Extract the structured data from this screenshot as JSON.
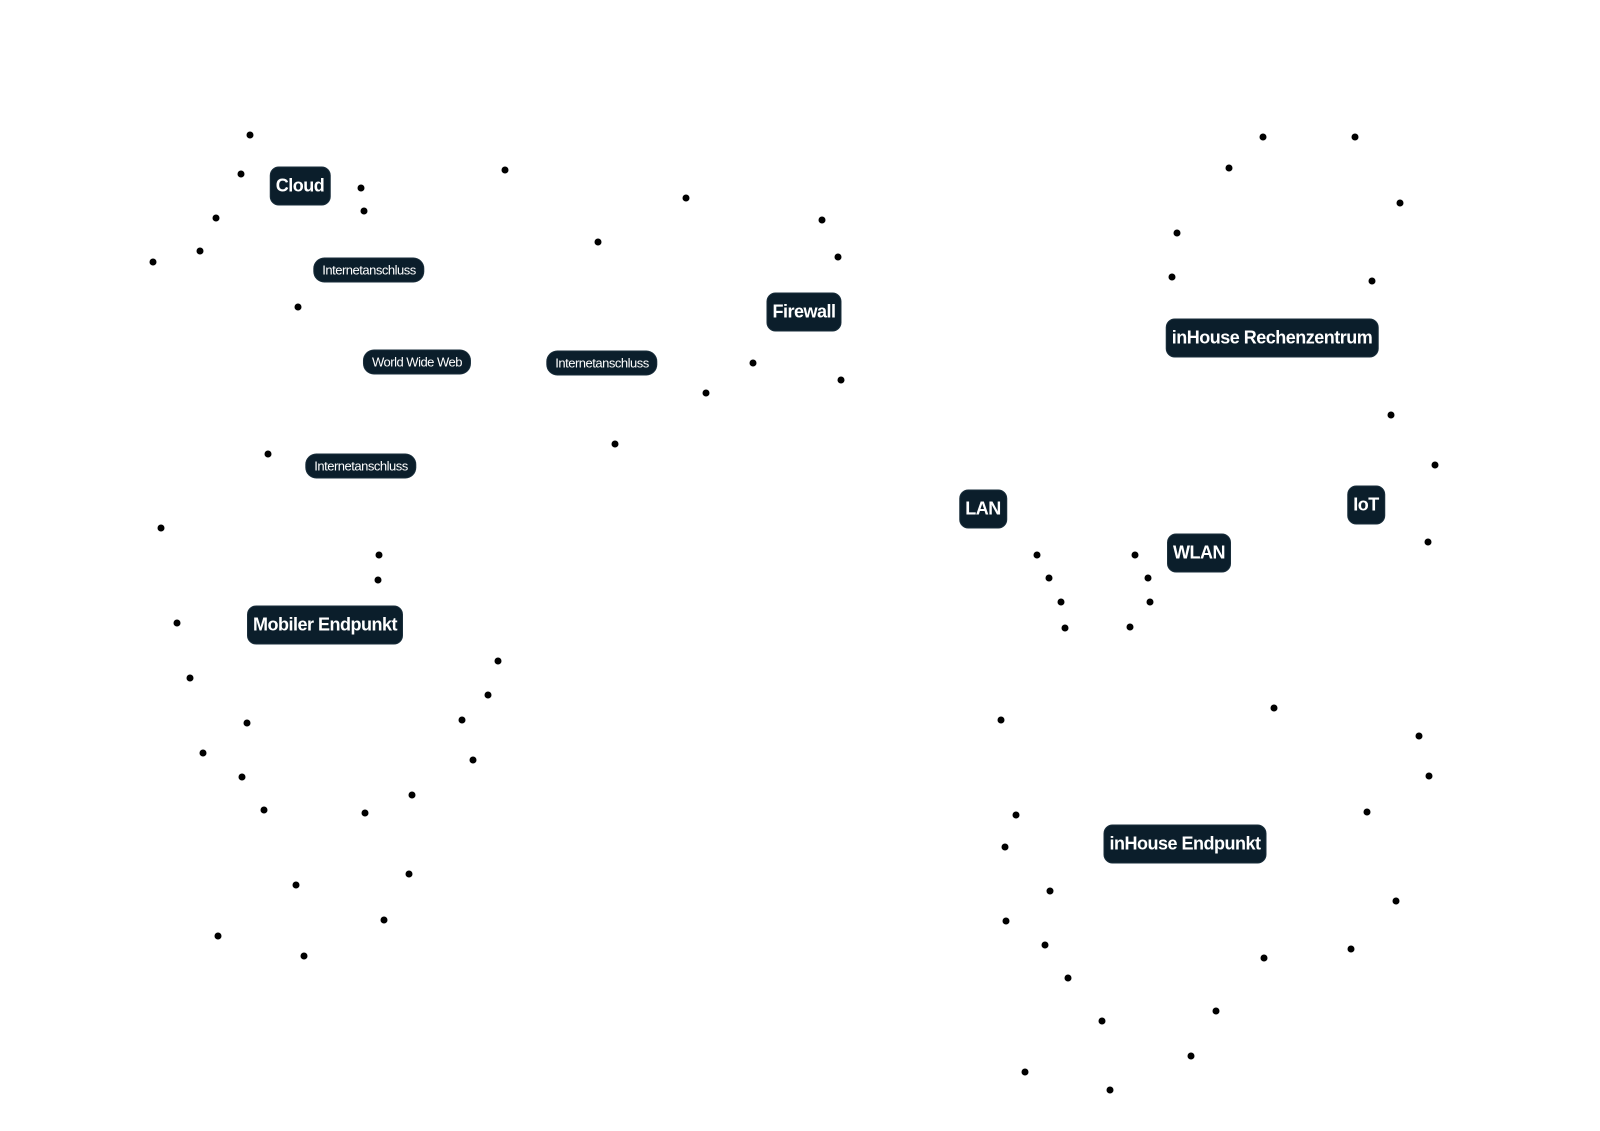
{
  "diagram": {
    "nodes": [
      {
        "id": "cloud",
        "label": "Cloud"
      },
      {
        "id": "internetanschluss-1",
        "label": "Internetanschluss"
      },
      {
        "id": "world-wide-web",
        "label": "World Wide Web"
      },
      {
        "id": "internetanschluss-2",
        "label": "Internetanschluss"
      },
      {
        "id": "internetanschluss-3",
        "label": "Internetanschluss"
      },
      {
        "id": "firewall",
        "label": "Firewall"
      },
      {
        "id": "mobiler-endpunkt",
        "label": "Mobiler Endpunkt"
      },
      {
        "id": "inhouse-rechenzentrum",
        "label": "inHouse Rechenzentrum"
      },
      {
        "id": "lan",
        "label": "LAN"
      },
      {
        "id": "wlan",
        "label": "WLAN"
      },
      {
        "id": "iot",
        "label": "IoT"
      },
      {
        "id": "inhouse-endpunkt",
        "label": "inHouse Endpunkt"
      }
    ]
  }
}
